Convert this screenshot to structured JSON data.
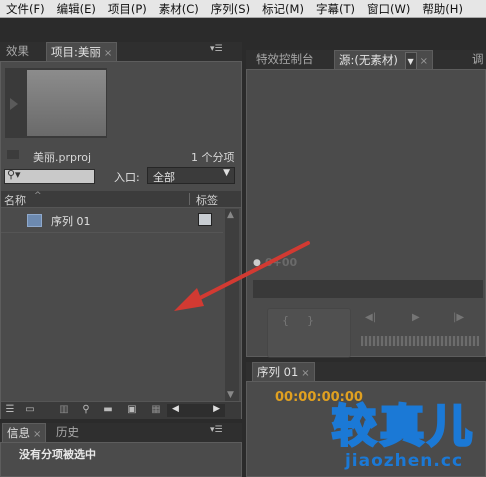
{
  "menu": [
    "文件(F)",
    "编辑(E)",
    "项目(P)",
    "素材(C)",
    "序列(S)",
    "标记(M)",
    "字幕(T)",
    "窗口(W)",
    "帮助(H)"
  ],
  "project_panel": {
    "tab_effects": "效果",
    "tab_project": "项目:美丽",
    "project_name": "美丽.prproj",
    "item_count": "1 个分项",
    "entry_label": "入口:",
    "entry_value": "全部",
    "col_name": "名称",
    "col_label": "标签",
    "rows": [
      {
        "name": "序列 01"
      }
    ]
  },
  "effects_control": {
    "tab_effects_control": "特效控制台",
    "tab_source": "源:(无素材)",
    "tab_other": "调",
    "timecode": "0+00"
  },
  "timeline": {
    "tab_label": "序列 01",
    "timecode": "00:00:00:00"
  },
  "info_panel": {
    "tab_info": "信息",
    "tab_history": "历史",
    "status": "没有分项被选中"
  },
  "watermark": {
    "cn": "较真儿",
    "en": "jiaozhen.cc"
  },
  "colors": {
    "arrow": "#d23a32",
    "watermark_blue": "#1b79d6",
    "timecode_orange": "#e0a020"
  }
}
